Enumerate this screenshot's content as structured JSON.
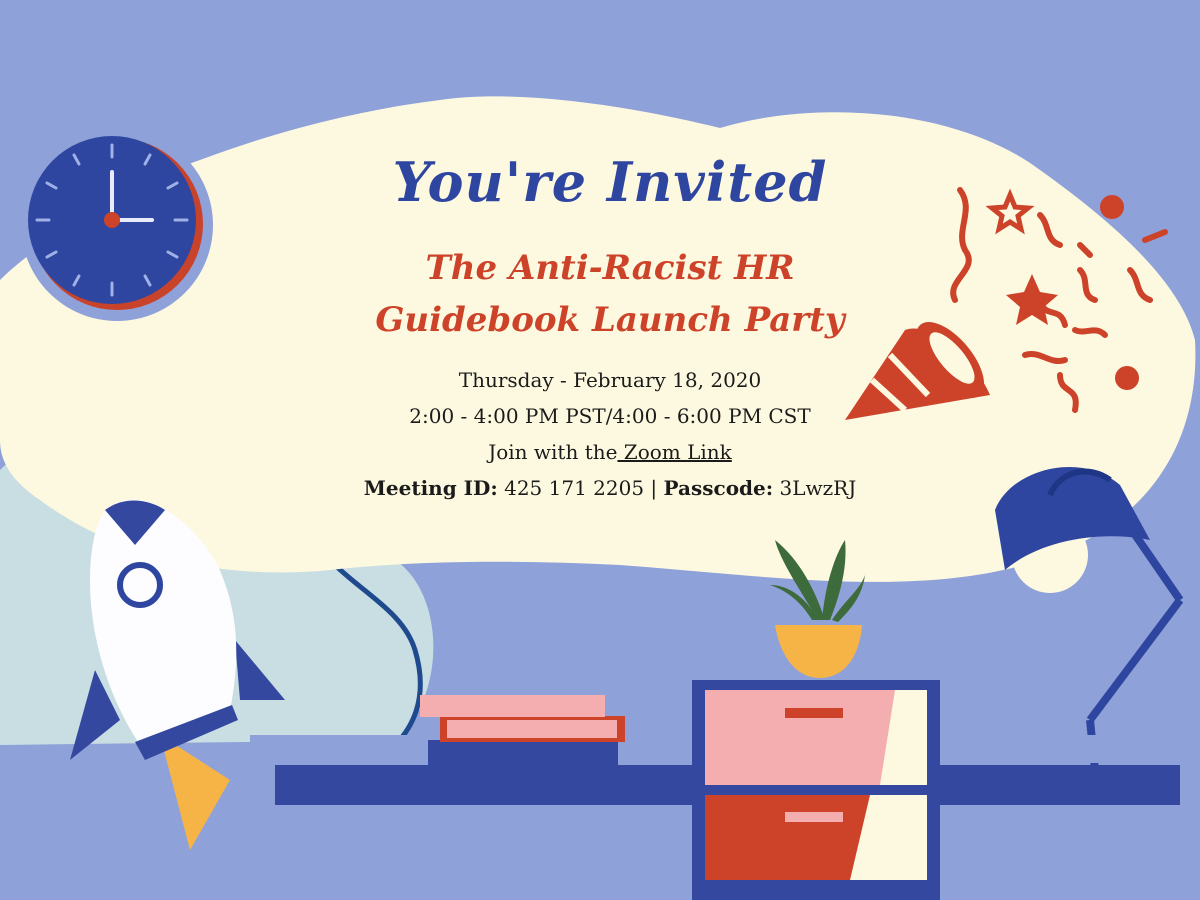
{
  "invitation": {
    "title": "You're Invited",
    "subtitle_line1": "The Anti-Racist HR",
    "subtitle_line2": "Guidebook Launch Party",
    "date": "Thursday - February 18, 2020",
    "time": "2:00 - 4:00 PM PST/4:00 - 6:00 PM CST",
    "join_prefix": "Join with the",
    "join_link": " Zoom Link",
    "meeting_id_label": "Meeting ID:",
    "meeting_id_value": " 425 171 2205 | ",
    "passcode_label": "Passcode:",
    "passcode_value": " 3LwzRJ"
  },
  "colors": {
    "background": "#8fa1d9",
    "cloud_cream": "#fdf9e0",
    "title_blue": "#2f46a0",
    "accent_red": "#cc432a",
    "navy": "#33489e",
    "pink": "#f4aeb0",
    "light_cloud": "#c9dee3",
    "yellow": "#f6b446"
  },
  "icons": [
    "clock-icon",
    "party-popper-icon",
    "desk-lamp-icon",
    "rocket-icon",
    "plant-icon",
    "book-stack-icon",
    "drawer-cabinet-icon"
  ]
}
